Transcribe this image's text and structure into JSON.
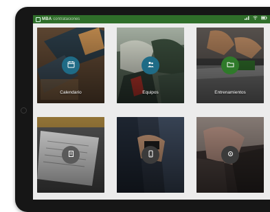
{
  "status_bar": {
    "brand": "MBA",
    "brand_sub": "contrataciones",
    "icons": [
      "app-logo-icon",
      "signal-icon",
      "wifi-icon",
      "battery-icon"
    ],
    "color": "#2f6e2a"
  },
  "tiles": [
    {
      "label": "Calendario",
      "icon": "calendar-icon",
      "badge_color": "#1f6b86"
    },
    {
      "label": "Equipos",
      "icon": "team-icon",
      "badge_color": "#1f6b86"
    },
    {
      "label": "Entrenamientos",
      "icon": "folder-icon",
      "badge_color": "#2f7a2a"
    },
    {
      "label": "",
      "icon": "document-icon",
      "badge_color": "#5a5a5a"
    },
    {
      "label": "",
      "icon": "phone-icon",
      "badge_color": "#3b3b3b"
    },
    {
      "label": "",
      "icon": "settings-icon",
      "badge_color": "#3b3b3b"
    }
  ]
}
